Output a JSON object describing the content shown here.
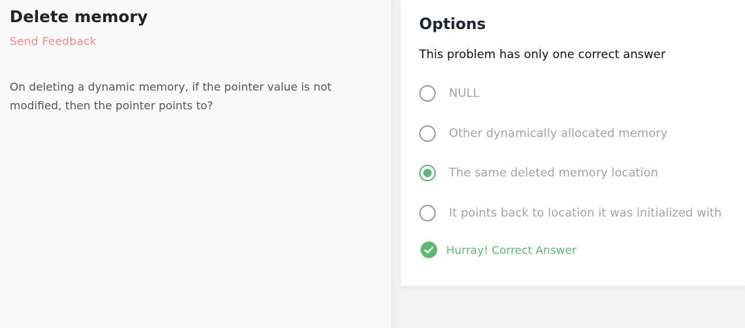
{
  "question": {
    "title": "Delete memory",
    "feedback_link": "Send Feedback",
    "text": "On deleting a dynamic memory, if the pointer value is not modified, then the pointer points to?"
  },
  "options_panel": {
    "title": "Options",
    "subtitle": "This problem has only one correct answer",
    "options": [
      {
        "label": "NULL",
        "selected": false
      },
      {
        "label": "Other dynamically allocated memory",
        "selected": false
      },
      {
        "label": "The same deleted memory location",
        "selected": true
      },
      {
        "label": "It points back to location it was initialized with",
        "selected": false
      }
    ],
    "result": {
      "icon": "check-circle-icon",
      "text": "Hurray! Correct Answer"
    }
  },
  "colors": {
    "accent_green": "#5cb874",
    "feedback_red": "#f08a8a",
    "radio_gray": "#9a9a9a"
  }
}
